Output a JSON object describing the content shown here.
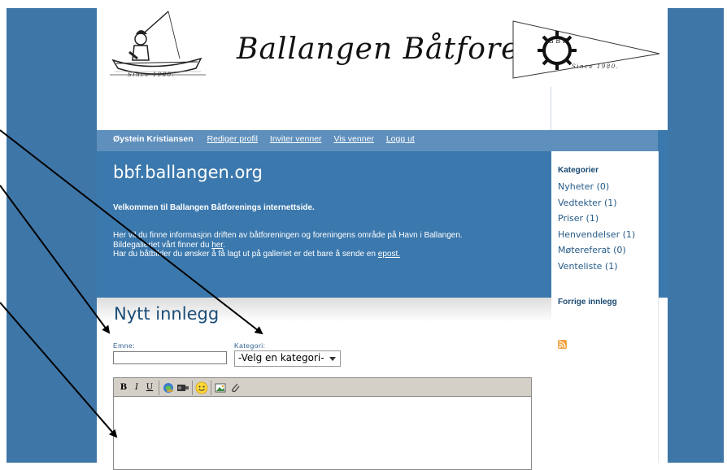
{
  "header": {
    "site_title": "Ballangen Båtforening",
    "logo_left_caption": "Since 1980.",
    "logo_right_caption": "Since 1980.",
    "logo_right_letters": "B B F"
  },
  "nav": {
    "user": "Øystein Kristiansen",
    "links": [
      "Rediger profil",
      "Inviter venner",
      "Vis venner",
      "Logg ut"
    ]
  },
  "content": {
    "domain": "bbf.ballangen.org",
    "welcome": "Velkommen til Ballangen Båtforenings internettside.",
    "line1": "Her vil du finne informasjon driften av båtforeningen og foreningens område på Havn i Ballangen.",
    "line2_pre": "Bildegalleriet vårt finner du ",
    "line2_link": "her",
    "line2_post": ".",
    "line3_pre": "Har du båtbilder du ønsker å få lagt ut på galleriet er det bare å sende en ",
    "line3_link": "epost."
  },
  "sidebar": {
    "heading": "Kategorier",
    "categories": [
      "Nyheter (0)",
      "Vedtekter (1)",
      "Priser (1)",
      "Henvendelser (1)",
      "Møtereferat (0)",
      "Venteliste (1)"
    ],
    "previous": "Forrige innlegg",
    "rss_icon": "rss-feed-icon"
  },
  "form": {
    "title": "Nytt innlegg",
    "subject_label": "Emne:",
    "subject_value": "",
    "category_label": "Kategori:",
    "category_selected": "-Velg en kategori-"
  },
  "toolbar": {
    "bold": "B",
    "italic": "I",
    "underline": "U",
    "icons": [
      "bold-icon",
      "italic-icon",
      "underline-icon",
      "link-icon",
      "video-icon",
      "smiley-icon",
      "image-icon",
      "attachment-icon"
    ]
  },
  "colors": {
    "primary_blue": "#3b78ad",
    "nav_blue": "#5f8fbc",
    "heading_blue": "#1b4d78"
  }
}
